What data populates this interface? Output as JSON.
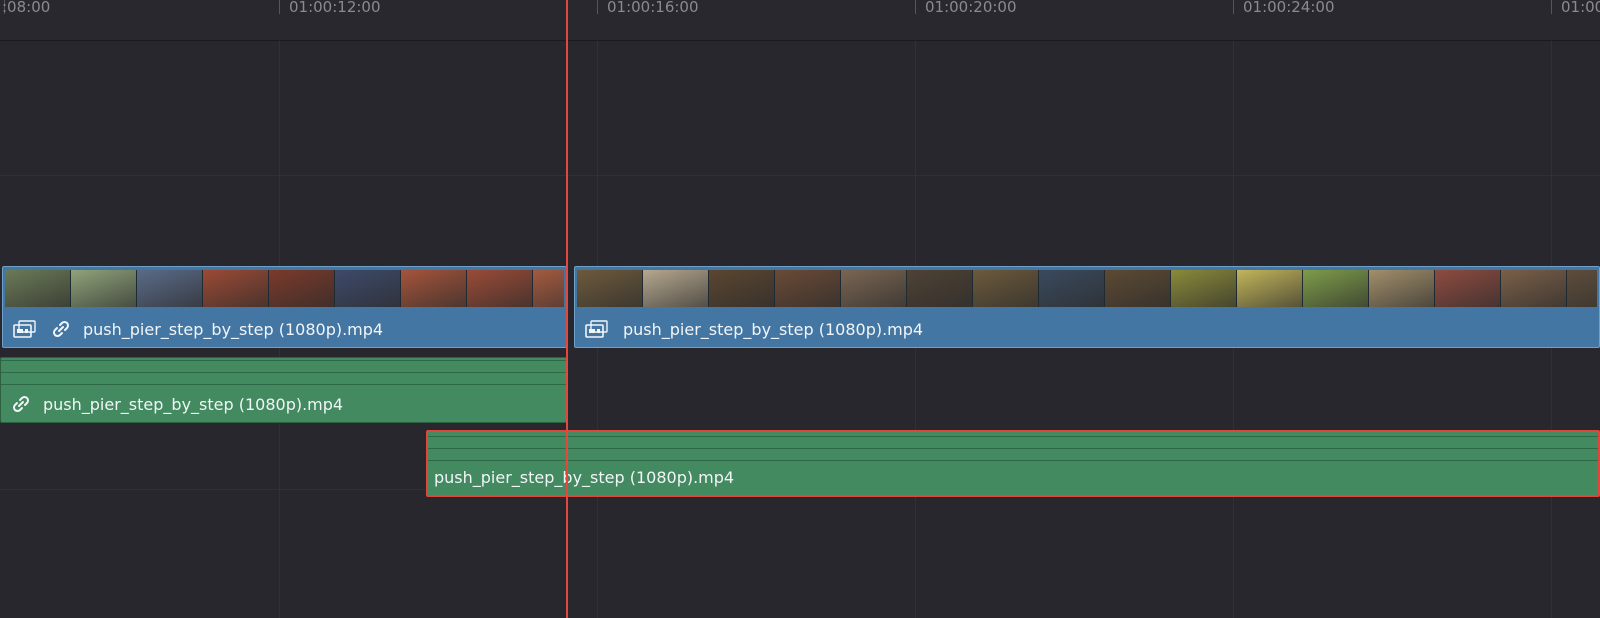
{
  "ruler": {
    "timecodes": [
      ":08:00",
      "01:00:12:00",
      "01:00:16:00",
      "01:00:20:00",
      "01:00:24:00",
      "01:00"
    ]
  },
  "video_track": {
    "clips": [
      {
        "name": "push_pier_step_by_step (1080p).mp4",
        "linked": true
      },
      {
        "name": "push_pier_step_by_step (1080p).mp4",
        "linked": false
      }
    ],
    "thumb_colors_a": [
      "#6b7a57",
      "#8fa37a",
      "#5a6b88",
      "#9b4a35",
      "#7b3a2b",
      "#3d4a6a",
      "#a5543b",
      "#9a4b36",
      "#a35a3f",
      "#c9c6c0"
    ],
    "thumb_colors_b": [
      "#6d5a3c",
      "#b6a88f",
      "#5b4630",
      "#6a4a36",
      "#7a6552",
      "#4e4234",
      "#6c5a3c",
      "#3a4a5e",
      "#5c4a33",
      "#8a8a3a",
      "#c2b55a",
      "#7e9c4a",
      "#a28f6b",
      "#8e4b40",
      "#7a5f48",
      "#5d4d3c"
    ]
  },
  "audio_track_1": {
    "clip": {
      "name": "push_pier_step_by_step (1080p).mp4",
      "linked": true
    }
  },
  "audio_track_2": {
    "clip": {
      "name": "push_pier_step_by_step (1080p).mp4",
      "linked": false,
      "selected": true
    }
  },
  "colors": {
    "video_clip": "#4376a2",
    "audio_clip": "#438a60",
    "playhead": "#e5463e",
    "background": "#27272d"
  }
}
